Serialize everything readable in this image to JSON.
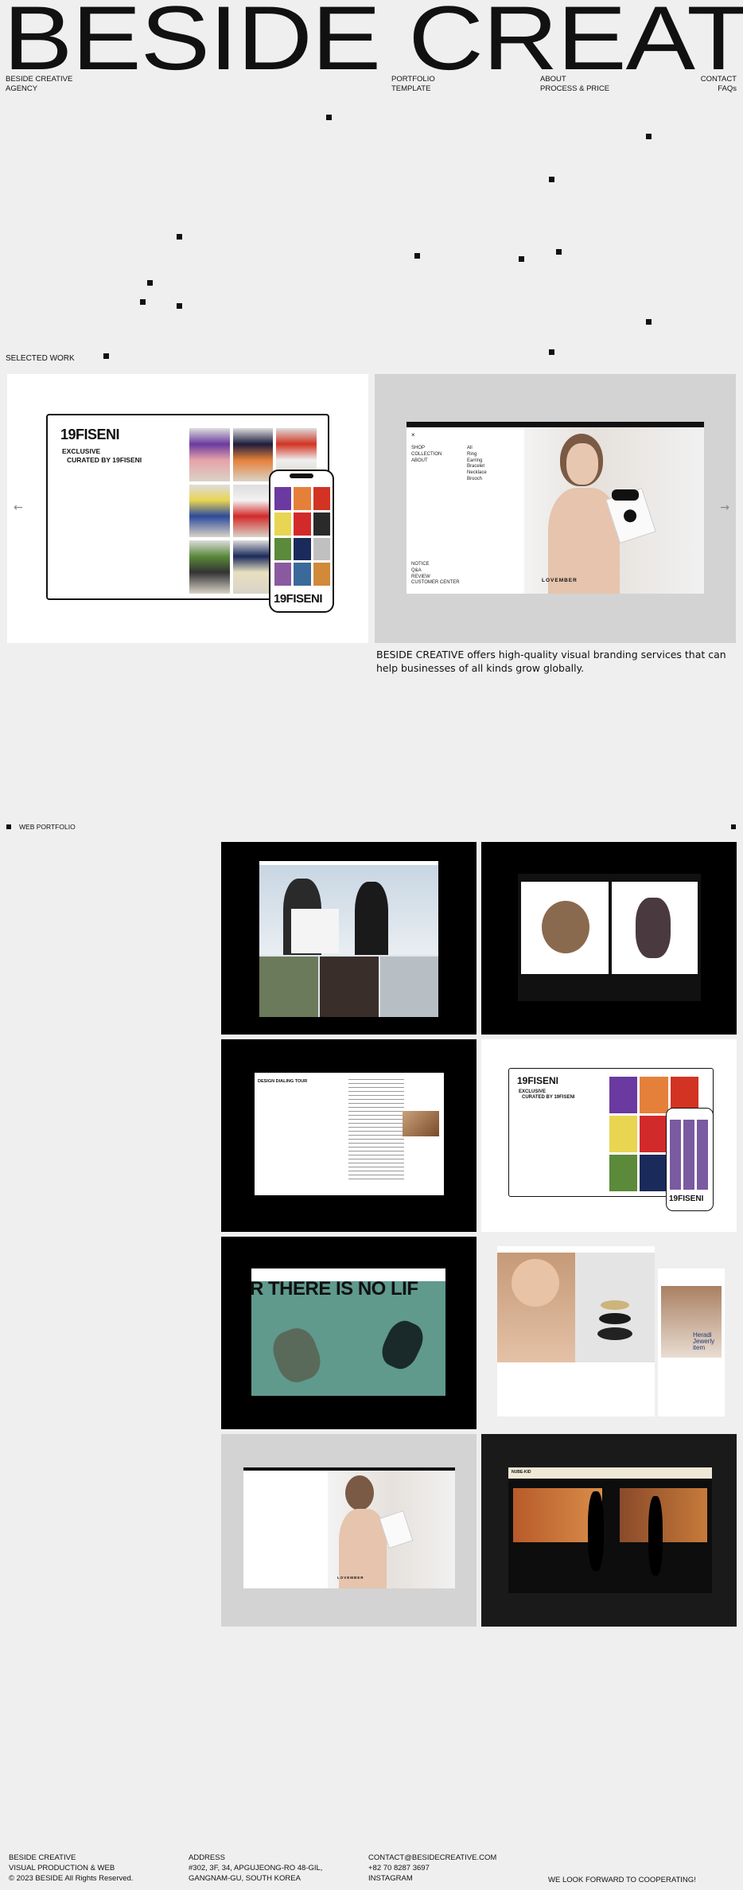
{
  "brand": {
    "title": "BESIDE CREATIVE"
  },
  "nav": {
    "agency": [
      "BESIDE CREATIVE",
      "AGENCY"
    ],
    "portfolio": "PORTFOLIO",
    "template": "TEMPLATE",
    "about": "ABOUT",
    "process": "PROCESS & PRICE",
    "contact": "CONTACT",
    "faqs": "FAQs"
  },
  "selected_work": {
    "label": "SELECTED WORK",
    "tagline": "BESIDE CREATIVE offers high-quality visual branding services that can help businesses of all kinds grow globally.",
    "prev_icon": "arrow-left-icon",
    "next_icon": "arrow-right-icon",
    "slide1": {
      "logo": "19FISENI",
      "line1": "EXCLUSIVE",
      "line2": "CURATED BY 19FISENI",
      "phone_logo": "19FISENI"
    },
    "slide2": {
      "menu": [
        "SHOP",
        "COLLECTION",
        "ABOUT"
      ],
      "submenu": [
        "All",
        "Ring",
        "Earring",
        "Bracelet",
        "Necklace",
        "Brooch"
      ],
      "footer_menu": [
        "NOTICE",
        "Q&A",
        "REVIEW",
        "CUSTOMER CENTER"
      ],
      "brand": "LOVEMBER"
    }
  },
  "web_portfolio": {
    "label": "WEB PORTFOLIO",
    "tile3_title": "DESIGN DIALING TOUR",
    "tile4_logo": "19FISENI",
    "tile4_line1": "EXCLUSIVE",
    "tile4_line2": "CURATED BY 19FISENI",
    "tile5_banner": "R THERE IS NO LIF",
    "tile6_caption": "Heradi Jewerly item",
    "tile7_brand": "LOVEMBER",
    "tile8_brand": "NUBE-KID"
  },
  "footer": {
    "company": [
      "BESIDE CREATIVE",
      "VISUAL PRODUCTION & WEB",
      "© 2023 BESIDE All Rights Reserved."
    ],
    "address": [
      "ADDRESS",
      "#302, 3F, 34, APGUJEONG-RO 48-GIL,",
      "GANGNAM-GU, SOUTH KOREA"
    ],
    "contact": [
      "CONTACT@BESIDECREATIVE.COM",
      "+82 70 8287 3697",
      "INSTAGRAM"
    ],
    "closing": "WE LOOK FORWARD TO COOPERATING!"
  },
  "colors": {
    "background": "#efefef",
    "ink": "#111111",
    "tile_dark": "#000000",
    "teal": "#5f9a8d"
  }
}
